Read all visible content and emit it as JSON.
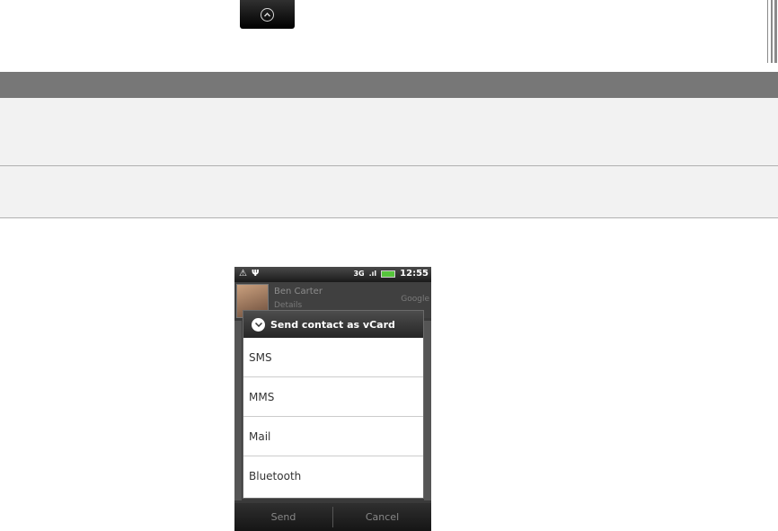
{
  "top_button": {
    "icon": "chevron-up-icon"
  },
  "phone": {
    "status_bar": {
      "left_icons": [
        "warning-icon",
        "usb-icon"
      ],
      "network": "3G",
      "signal_icon": "signal-icon",
      "battery_icon": "battery-icon",
      "time": "12:55"
    },
    "contact": {
      "name": "Ben Carter",
      "source": "Google",
      "subtitle": "Details"
    },
    "dialog": {
      "title": "Send contact as vCard",
      "title_icon": "chevron-down-circle-icon",
      "options": [
        "SMS",
        "MMS",
        "Mail",
        "Bluetooth"
      ]
    },
    "buttons": {
      "send": "Send",
      "cancel": "Cancel"
    }
  },
  "colors": {
    "table_header": "#777777",
    "table_row": "#f2f2f2",
    "battery_green": "#56c53c"
  }
}
